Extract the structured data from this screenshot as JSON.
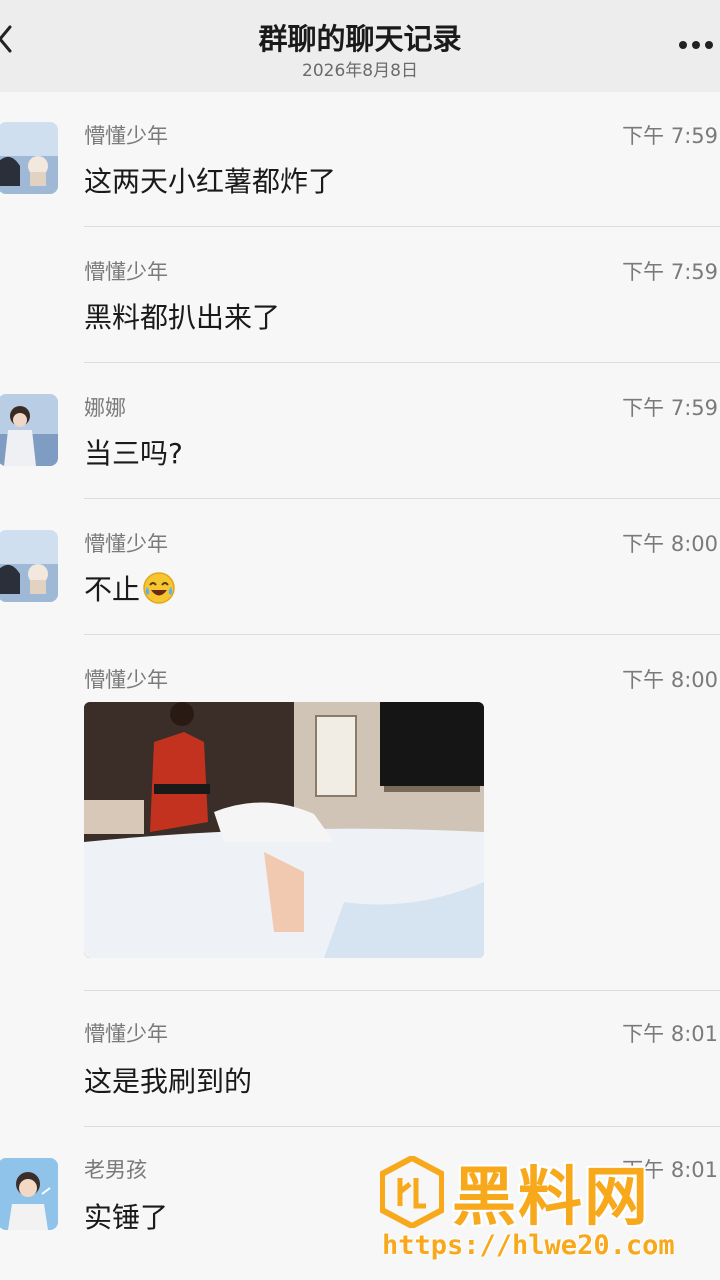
{
  "header": {
    "title": "群聊的聊天记录",
    "date": "2026年8月8日"
  },
  "messages": [
    {
      "sender": "懵懂少年",
      "time": "下午 7:59",
      "text": "这两天小红薯都炸了"
    },
    {
      "sender": "懵懂少年",
      "time": "下午 7:59",
      "text": "黑料都扒出来了"
    },
    {
      "sender": "娜娜",
      "time": "下午 7:59",
      "text": "当三吗?"
    },
    {
      "sender": "懵懂少年",
      "time": "下午 8:00",
      "text": "不止"
    },
    {
      "sender": "懵懂少年",
      "time": "下午 8:00",
      "text": ""
    },
    {
      "sender": "懵懂少年",
      "time": "下午 8:01",
      "text": "这是我刷到的"
    },
    {
      "sender": "老男孩",
      "time": "下午 8:01",
      "text": "实锤了"
    }
  ],
  "watermark": {
    "brand": "黑料网",
    "url": "https://hlwe20.com"
  },
  "colors": {
    "header_bg": "#ededed",
    "watermark": "#f7a81b"
  }
}
